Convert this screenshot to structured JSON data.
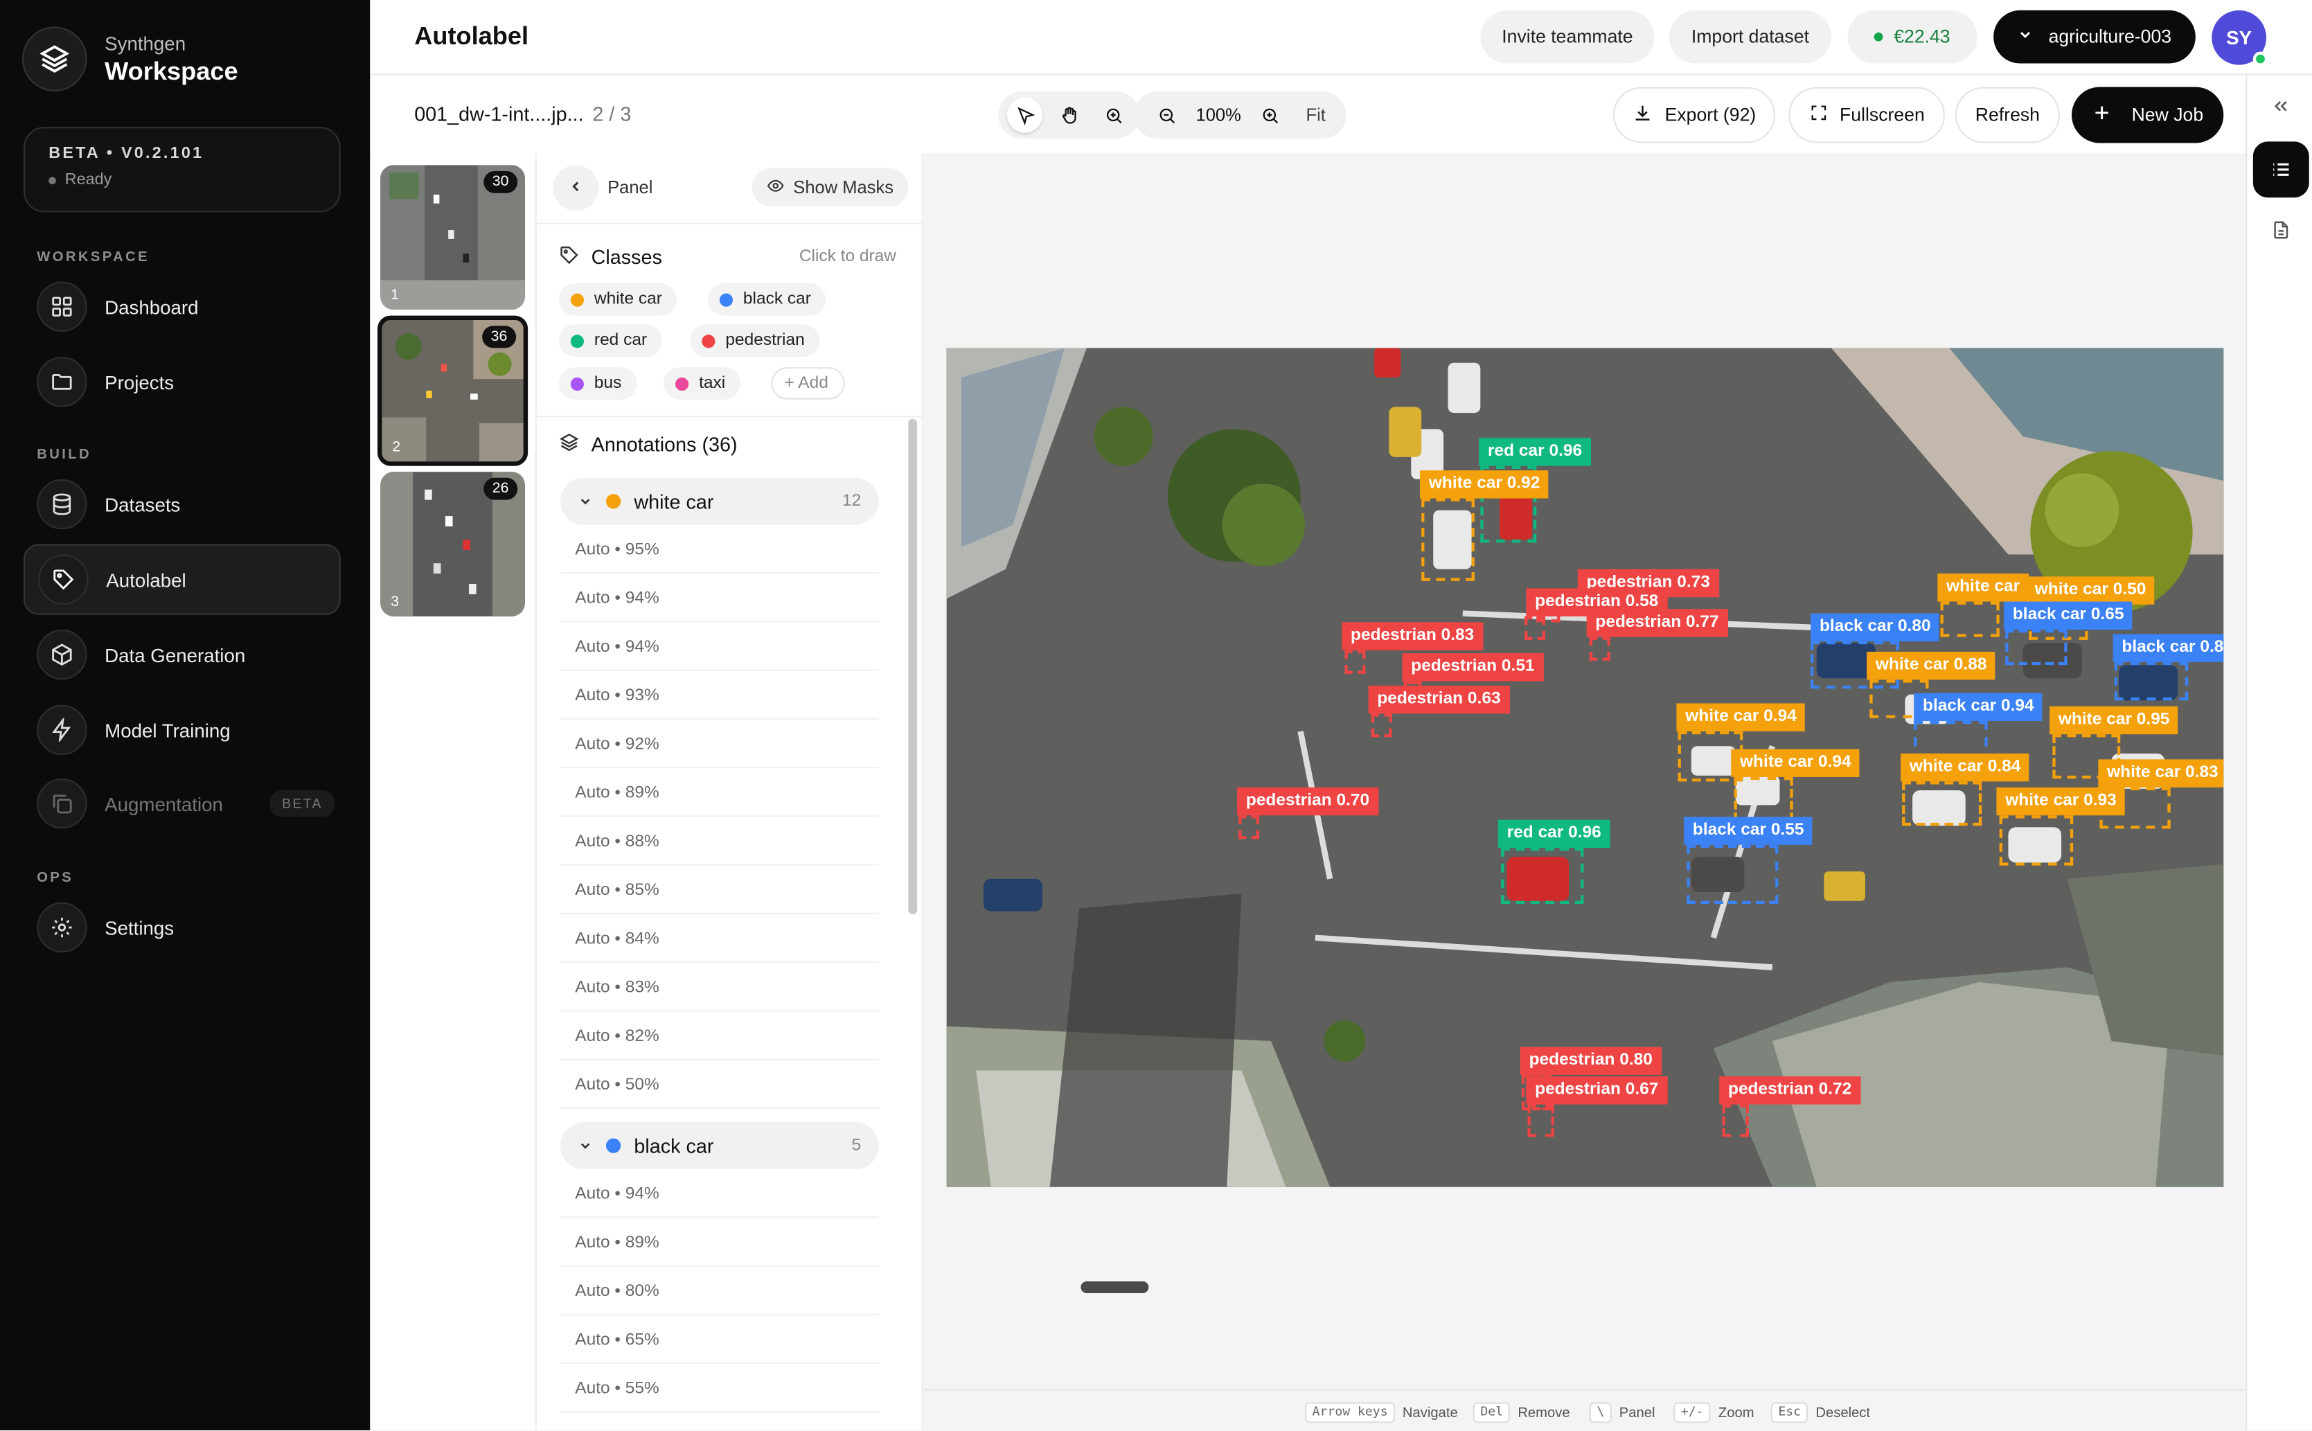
{
  "colors": {
    "white_car": "#f5a10c",
    "black_car": "#3b82f6",
    "red_car": "#10b981",
    "pedestrian": "#ef4444",
    "bus": "#a855f7",
    "taxi": "#ec4899",
    "accent_dark": "#0b0b0b"
  },
  "brand": {
    "subtitle": "Synthgen",
    "title": "Workspace",
    "icon": "layers-logo-icon"
  },
  "version": {
    "label": "BETA • V0.2.101",
    "status": "Ready"
  },
  "nav": {
    "section_workspace": "WORKSPACE",
    "section_build": "BUILD",
    "section_ops": "OPS",
    "dashboard": "Dashboard",
    "projects": "Projects",
    "datasets": "Datasets",
    "autolabel": "Autolabel",
    "data_generation": "Data Generation",
    "model_training": "Model Training",
    "augmentation": "Augmentation",
    "augmentation_badge": "BETA",
    "settings": "Settings"
  },
  "header": {
    "title": "Autolabel",
    "invite": "Invite teammate",
    "import": "Import dataset",
    "credits": "€22.43",
    "project": "agriculture-003",
    "avatar": "SY"
  },
  "toolbar": {
    "filename": "001_dw-1-int....jp...",
    "position": "2 / 3",
    "zoom": "100%",
    "fit": "Fit",
    "export": "Export (92)",
    "fullscreen": "Fullscreen",
    "refresh": "Refresh",
    "new_job": "New Job"
  },
  "thumbnails": [
    {
      "count": "30",
      "index": "1"
    },
    {
      "count": "36",
      "index": "2"
    },
    {
      "count": "26",
      "index": "3"
    }
  ],
  "panel": {
    "label": "Panel",
    "show_masks": "Show Masks",
    "classes_title": "Classes",
    "classes_hint": "Click to draw",
    "classes": [
      {
        "name": "white car"
      },
      {
        "name": "black car"
      },
      {
        "name": "red car"
      },
      {
        "name": "pedestrian"
      },
      {
        "name": "bus"
      },
      {
        "name": "taxi"
      }
    ],
    "add_label": "+ Add",
    "annotations_title": "Annotations (36)",
    "groups": [
      {
        "name": "white car",
        "count": "12",
        "items": [
          "Auto • 95%",
          "Auto • 94%",
          "Auto • 94%",
          "Auto • 93%",
          "Auto • 92%",
          "Auto • 89%",
          "Auto • 88%",
          "Auto • 85%",
          "Auto • 84%",
          "Auto • 83%",
          "Auto • 82%",
          "Auto • 50%"
        ]
      },
      {
        "name": "black car",
        "count": "5",
        "items": [
          "Auto • 94%",
          "Auto • 89%",
          "Auto • 80%",
          "Auto • 65%",
          "Auto • 55%"
        ]
      }
    ]
  },
  "detections": [
    {
      "label": "red car 0.96"
    },
    {
      "label": "white car 0.92"
    },
    {
      "label": "pedestrian 0.73"
    },
    {
      "label": "pedestrian 0.58"
    },
    {
      "label": "pedestrian 0.77"
    },
    {
      "label": "pedestrian 0.83"
    },
    {
      "label": "pedestrian 0.51"
    },
    {
      "label": "pedestrian 0.63"
    },
    {
      "label": "pedestrian 0.70"
    },
    {
      "label": "red car 0.96"
    },
    {
      "label": "white car"
    },
    {
      "label": "white car 0.50"
    },
    {
      "label": "black car 0.65"
    },
    {
      "label": "black car 0.80"
    },
    {
      "label": "black car 0.8"
    },
    {
      "label": "white car 0.88"
    },
    {
      "label": "black car 0.94"
    },
    {
      "label": "white car 0.94"
    },
    {
      "label": "white car 0.95"
    },
    {
      "label": "white car 0.94"
    },
    {
      "label": "white car 0.84"
    },
    {
      "label": "white car 0.83"
    },
    {
      "label": "white car 0.93"
    },
    {
      "label": "black car 0.55"
    },
    {
      "label": "pedestrian 0.80"
    },
    {
      "label": "pedestrian 0.67"
    },
    {
      "label": "pedestrian 0.72"
    }
  ],
  "footer": {
    "items": [
      {
        "key": "Arrow keys",
        "action": "Navigate"
      },
      {
        "key": "Del",
        "action": "Remove"
      },
      {
        "key": "\\",
        "action": "Panel"
      },
      {
        "key": "+/-",
        "action": "Zoom"
      },
      {
        "key": "Esc",
        "action": "Deselect"
      }
    ]
  }
}
